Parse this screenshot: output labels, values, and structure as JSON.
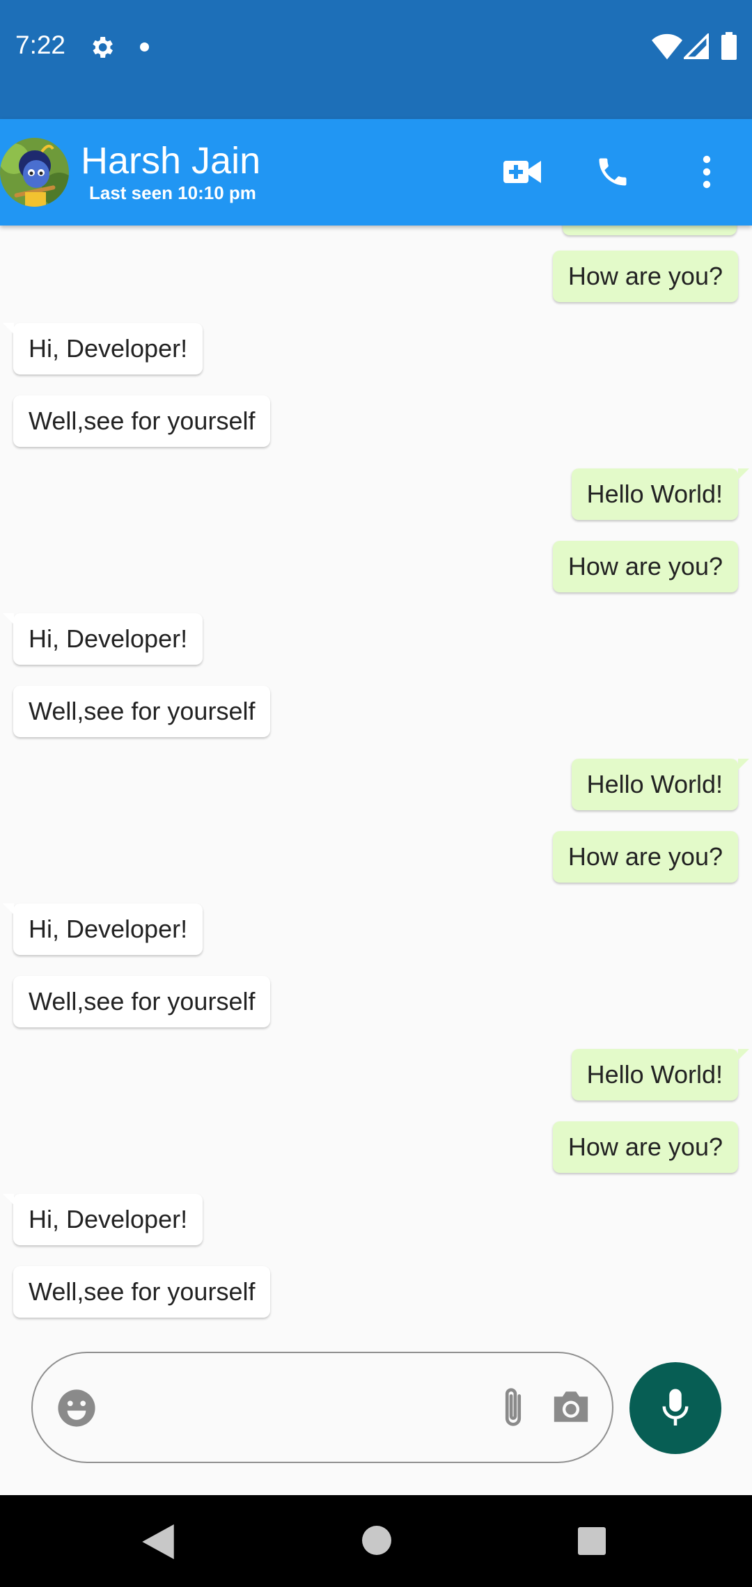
{
  "status_bar": {
    "time": "7:22",
    "icons": [
      "gear-icon",
      "notification-dot",
      "wifi-icon",
      "signal-icon",
      "battery-icon"
    ]
  },
  "header": {
    "contact_name": "Harsh Jain",
    "last_seen": "Last seen 10:10 pm",
    "actions": [
      "video-call-icon",
      "phone-icon",
      "more-vert-icon"
    ]
  },
  "messages": [
    {
      "direction": "out",
      "text": "How are you?"
    },
    {
      "direction": "in",
      "text": "Hi, Developer!"
    },
    {
      "direction": "in",
      "text": "Well,see for yourself"
    },
    {
      "direction": "out",
      "text": "Hello World!"
    },
    {
      "direction": "out",
      "text": "How are you?"
    },
    {
      "direction": "in",
      "text": "Hi, Developer!"
    },
    {
      "direction": "in",
      "text": "Well,see for yourself"
    },
    {
      "direction": "out",
      "text": "Hello World!"
    },
    {
      "direction": "out",
      "text": "How are you?"
    },
    {
      "direction": "in",
      "text": "Hi, Developer!"
    },
    {
      "direction": "in",
      "text": "Well,see for yourself"
    },
    {
      "direction": "out",
      "text": "Hello World!"
    },
    {
      "direction": "out",
      "text": "How are you?"
    },
    {
      "direction": "in",
      "text": "Hi, Developer!"
    },
    {
      "direction": "in",
      "text": "Well,see for yourself"
    }
  ],
  "composer": {
    "value": "",
    "placeholder": "",
    "icons": [
      "emoji-icon",
      "attach-icon",
      "camera-icon",
      "mic-icon"
    ]
  },
  "colors": {
    "status_bar": "#1d6fb8",
    "app_bar": "#2196f3",
    "incoming_bubble": "#ffffff",
    "outgoing_bubble": "#e3fac9",
    "mic_button": "#075e54"
  }
}
